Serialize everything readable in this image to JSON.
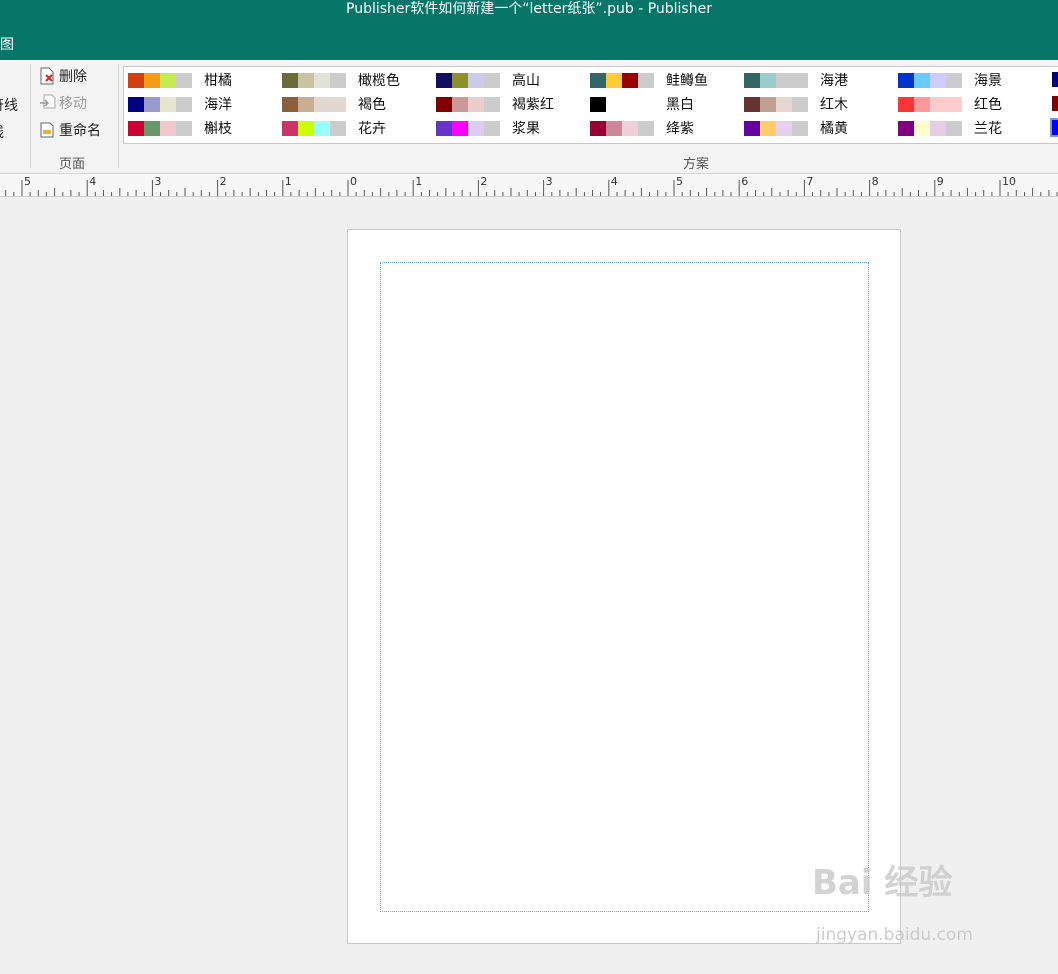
{
  "window": {
    "title": "Publisher软件如何新建一个“letter纸张”.pub - Publisher"
  },
  "tabs": {
    "partial_tab_label": "视图"
  },
  "ribbon": {
    "left_partial": [
      "符线",
      "线"
    ],
    "page_group": {
      "delete_label": "删除",
      "move_label": "移动",
      "rename_label": "重命名",
      "group_label": "页面"
    },
    "scheme_group_label": "方案"
  },
  "schemes": [
    {
      "name": "柑橘",
      "colors": [
        "#d04010",
        "#f79a13",
        "#c2eb54",
        "#cccccc"
      ]
    },
    {
      "name": "橄榄色",
      "colors": [
        "#6b6b39",
        "#c9c3a4",
        "#e2e2d6",
        "#cccccc"
      ]
    },
    {
      "name": "高山",
      "colors": [
        "#100d63",
        "#8e8e2b",
        "#ccccea",
        "#cccccc"
      ]
    },
    {
      "name": "鲑鳟鱼",
      "colors": [
        "#336666",
        "#ffcc33",
        "#990000",
        "#cccccc"
      ]
    },
    {
      "name": "海港",
      "colors": [
        "#336666",
        "#99cccc",
        "#cccccc",
        "#cccccc"
      ]
    },
    {
      "name": "海景",
      "colors": [
        "#0033cc",
        "#66ccff",
        "#ccccff",
        "#cccccc"
      ]
    },
    {
      "name": "海洋",
      "colors": [
        "#000080",
        "#9999cc",
        "#e6e6cc",
        "#cccccc"
      ]
    },
    {
      "name": "褐色",
      "colors": [
        "#8b5e3c",
        "#c9ad94",
        "#e2d8cf",
        "#e2d8cf"
      ]
    },
    {
      "name": "褐紫红",
      "colors": [
        "#800000",
        "#cc9999",
        "#eccccc",
        "#cccccc"
      ]
    },
    {
      "name": "黑白",
      "colors": [
        "#000000",
        "#ffffff",
        "#ffffff",
        "#ffffff"
      ]
    },
    {
      "name": "红木",
      "colors": [
        "#663333",
        "#c0a090",
        "#e6d8d0",
        "#cccccc"
      ]
    },
    {
      "name": "红色",
      "colors": [
        "#ff3333",
        "#ff9999",
        "#ffcccc",
        "#ffcccc"
      ]
    },
    {
      "name": "槲枝",
      "colors": [
        "#cc0033",
        "#669966",
        "#f0c8d0",
        "#cccccc"
      ]
    },
    {
      "name": "花卉",
      "colors": [
        "#cc3366",
        "#ccff00",
        "#99ffff",
        "#cccccc"
      ]
    },
    {
      "name": "浆果",
      "colors": [
        "#6633cc",
        "#ff00ff",
        "#ddccf0",
        "#cccccc"
      ]
    },
    {
      "name": "绛紫",
      "colors": [
        "#990033",
        "#cc8899",
        "#eed0d8",
        "#cccccc"
      ]
    },
    {
      "name": "橘黄",
      "colors": [
        "#6600a0",
        "#ffcc66",
        "#e6d0f0",
        "#cccccc"
      ]
    },
    {
      "name": "兰花",
      "colors": [
        "#800080",
        "#ffffcc",
        "#e6cce6",
        "#cccccc"
      ]
    }
  ],
  "schemes_cut": [
    "#000080",
    "#800000",
    "#0000ff"
  ],
  "ruler": {
    "labels": [
      "5",
      "4",
      "3",
      "2",
      "1",
      "0",
      "1",
      "2",
      "3",
      "4",
      "5",
      "6",
      "7",
      "8",
      "9",
      "10"
    ]
  },
  "watermark": {
    "main": "Bai 经验",
    "sub": "jingyan.baidu.com"
  }
}
